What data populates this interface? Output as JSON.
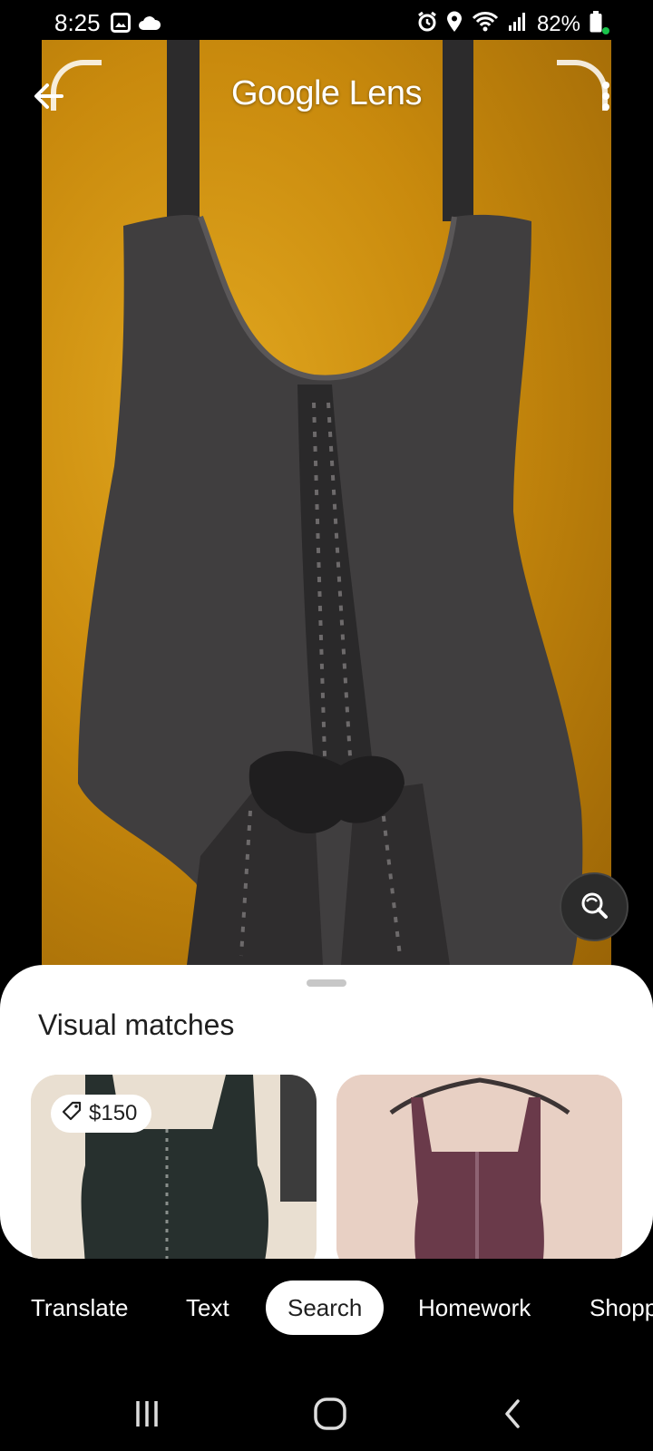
{
  "status_bar": {
    "time": "8:25",
    "battery": "82%",
    "icons": [
      "gallery-icon",
      "cloud-icon",
      "alarm-icon",
      "location-icon",
      "wifi-icon",
      "signal-icon",
      "battery-icon"
    ],
    "dot_color": "#19c34b"
  },
  "header": {
    "title": "Google Lens",
    "back_icon": "arrow-left-icon",
    "more_icon": "more-vert-icon"
  },
  "colors": {
    "photo_background": "#c98a0d",
    "garment": "#3f3d3e",
    "sheet_background": "#ffffff",
    "active_tab_background": "#ffffff"
  },
  "sheet": {
    "title": "Visual matches",
    "matches": [
      {
        "price": "$150"
      },
      {
        "price": ""
      }
    ]
  },
  "tabs": [
    {
      "label": "Translate",
      "active": false
    },
    {
      "label": "Text",
      "active": false
    },
    {
      "label": "Search",
      "active": true
    },
    {
      "label": "Homework",
      "active": false
    },
    {
      "label": "Shopping",
      "active": false
    }
  ],
  "nav_bar": {
    "buttons": [
      "recent-apps-icon",
      "home-icon",
      "back-icon"
    ]
  }
}
